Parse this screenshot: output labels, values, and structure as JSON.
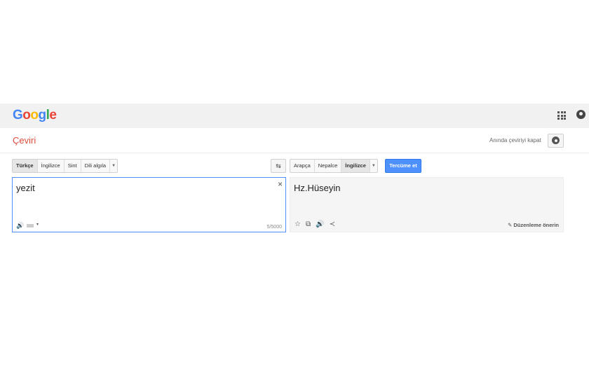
{
  "header": {
    "logo": {
      "letters": [
        "G",
        "o",
        "o",
        "g",
        "l",
        "e"
      ],
      "colors": [
        "#4285f4",
        "#ea4335",
        "#fbbc05",
        "#4285f4",
        "#34a853",
        "#ea4335"
      ]
    },
    "apps_icon": "grid-icon",
    "account_icon": "account-icon"
  },
  "title_bar": {
    "title": "Çeviri",
    "title_color": "#dd4b39",
    "instant_toggle_label": "Anında çeviriyi kapat",
    "settings_icon": "gear-icon"
  },
  "source_languages": [
    {
      "label": "Türkçe",
      "selected": true
    },
    {
      "label": "İngilizce",
      "selected": false
    },
    {
      "label": "Sint",
      "selected": false
    },
    {
      "label": "Dili algıla",
      "selected": false
    }
  ],
  "target_languages": [
    {
      "label": "Arapça",
      "selected": false
    },
    {
      "label": "Nepalce",
      "selected": false
    },
    {
      "label": "İngilizce",
      "selected": true
    }
  ],
  "swap_icon": "swap-icon",
  "translate_button": {
    "label": "Tercüme et",
    "color": "#4d90fe"
  },
  "source": {
    "text": "yezit",
    "char_count": "5/5000",
    "clear_symbol": "×",
    "speaker_symbol": "🔊",
    "kbd_caret": "▾"
  },
  "target": {
    "text": "Hz.Hüseyin",
    "tool_symbols": {
      "star": "☆",
      "copy": "⧉",
      "speaker": "🔊",
      "share": "≺"
    },
    "suggest_label": "Düzenleme önerin",
    "suggest_symbol": "✎"
  }
}
